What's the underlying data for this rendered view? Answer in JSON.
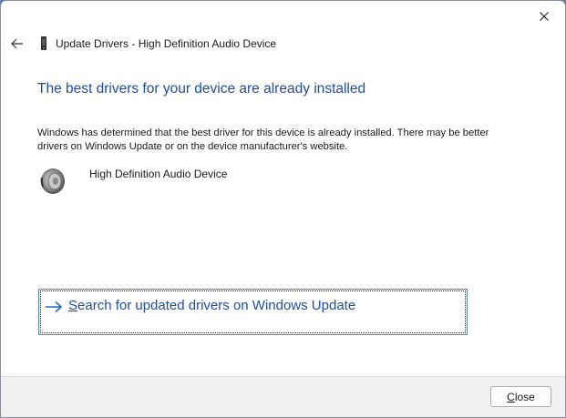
{
  "window": {
    "title": "Update Drivers - High Definition Audio Device",
    "close_icon": "close-icon",
    "back_icon": "back-arrow-icon"
  },
  "main": {
    "heading": "The best drivers for your device are already installed",
    "description": "Windows has determined that the best driver for this device is already installed. There may be better drivers on Windows Update or on the device manufacturer's website.",
    "device_name": "High Definition Audio Device",
    "device_icon": "speaker-icon"
  },
  "command_link": {
    "accel_letter": "S",
    "rest": "earch for updated drivers on Windows Update",
    "icon": "arrow-right-icon"
  },
  "footer": {
    "close_accel": "C",
    "close_rest": "lose"
  },
  "colors": {
    "accent": "#1f4e9c",
    "background": "#6a7fa6"
  }
}
